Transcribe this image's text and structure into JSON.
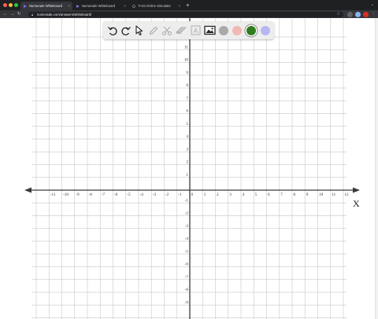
{
  "browser": {
    "tabs": [
      {
        "title": "Numerade Whiteboard",
        "active": true
      },
      {
        "title": "Numerade Whiteboard",
        "active": false
      },
      {
        "title": "TI-84 Online Simulator",
        "active": false
      }
    ],
    "new_tab_label": "+",
    "tab_menu_label": "⌄",
    "url": "numerade.com/answers/whiteboard/",
    "colors": {
      "tab_bar": "#1f2022",
      "toolbar": "#35363a",
      "accent": "#d93025"
    }
  },
  "toolbar": {
    "tools": [
      {
        "name": "undo",
        "icon": "undo-icon"
      },
      {
        "name": "redo",
        "icon": "redo-icon"
      },
      {
        "name": "select",
        "icon": "pointer-icon"
      },
      {
        "name": "pen",
        "icon": "pen-icon"
      },
      {
        "name": "scissors",
        "icon": "scissors-icon"
      },
      {
        "name": "eraser",
        "icon": "eraser-icon"
      },
      {
        "name": "text",
        "icon": "text-box-icon",
        "label": "A"
      },
      {
        "name": "image",
        "icon": "image-icon"
      }
    ],
    "colors": [
      "#a9a9a9",
      "#f2b8b4",
      "#2f7d1f",
      "#b7b7f2"
    ],
    "selected_color_index": 2
  },
  "graph": {
    "x_axis_label": "X",
    "x_ticks": [
      "-11",
      "-10",
      "-9",
      "-8",
      "-7",
      "-6",
      "-5",
      "-4",
      "-3",
      "-2",
      "-1",
      "0",
      "1",
      "2",
      "3",
      "4",
      "5",
      "6",
      "7",
      "8",
      "9",
      "10",
      "11",
      "12"
    ],
    "y_ticks_positive": [
      "11",
      "10",
      "9",
      "8",
      "7",
      "6",
      "5",
      "4",
      "3",
      "2",
      "1"
    ],
    "y_ticks_negative": [
      "-1",
      "-2",
      "-3",
      "-4",
      "-5",
      "-6",
      "-7",
      "-8",
      "-9"
    ],
    "x_range": [
      -11,
      12
    ],
    "y_range": [
      -9,
      11
    ],
    "grid": true
  }
}
